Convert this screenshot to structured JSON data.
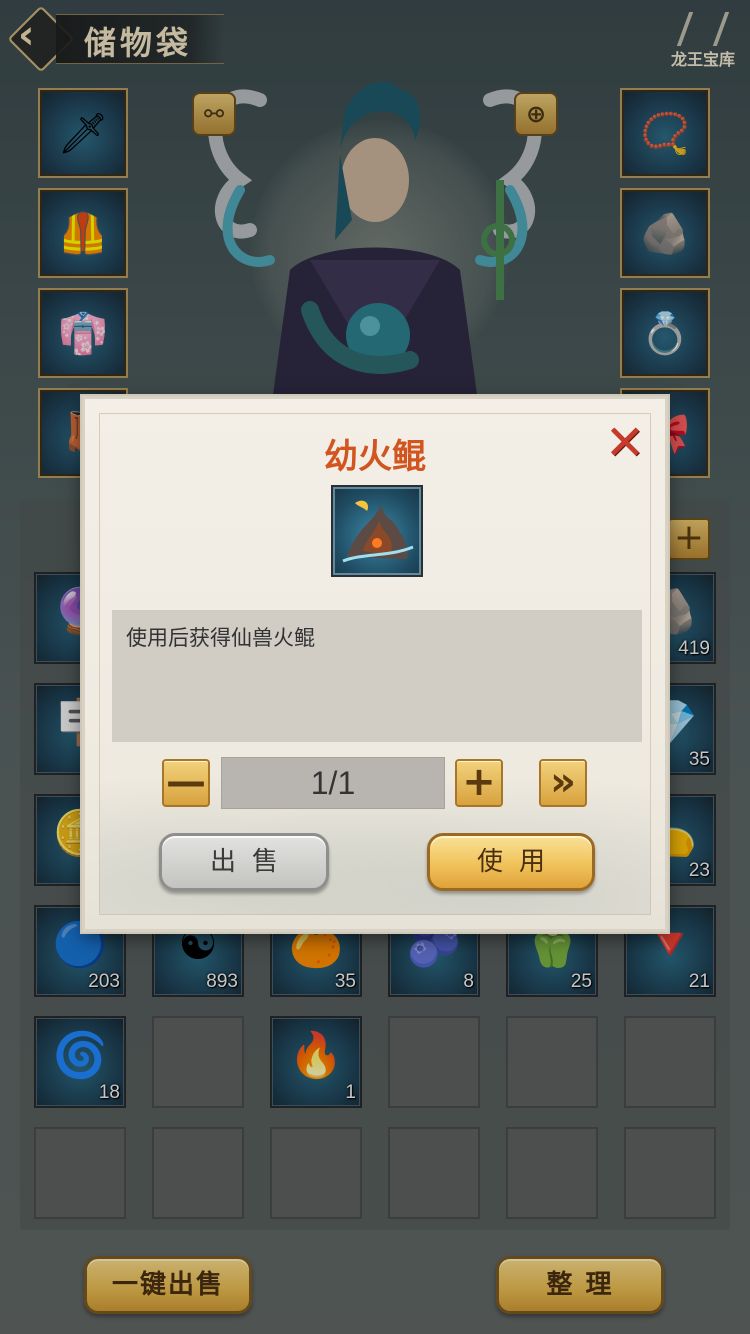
{
  "header": {
    "title": "储物袋",
    "logo_text": "龙王宝库"
  },
  "hero": {
    "left_button_icon": "armor-swap-icon",
    "right_button_icon": "magnify-icon"
  },
  "equipment": {
    "left": [
      {
        "icon": "sword-icon",
        "glyph": "🗡"
      },
      {
        "icon": "armor-icon",
        "glyph": "🦺"
      },
      {
        "icon": "robe-icon",
        "glyph": "👘"
      },
      {
        "icon": "boots-icon",
        "glyph": "👢"
      }
    ],
    "right": [
      {
        "icon": "bracelet-icon",
        "glyph": "📿"
      },
      {
        "icon": "jade-icon",
        "glyph": "🪨"
      },
      {
        "icon": "ring-icon",
        "glyph": "💍"
      },
      {
        "icon": "belt-icon",
        "glyph": "🎀"
      }
    ]
  },
  "inventory": {
    "rows": [
      [
        {
          "icon": "crystal-icon",
          "glyph": "🔮",
          "count": ""
        },
        {
          "icon": "",
          "glyph": "",
          "count": ""
        },
        {
          "icon": "",
          "glyph": "",
          "count": ""
        },
        {
          "icon": "",
          "glyph": "",
          "count": ""
        },
        {
          "icon": "",
          "glyph": "",
          "count": ""
        },
        {
          "icon": "ore-icon",
          "glyph": "🪨",
          "count": "419"
        }
      ],
      [
        {
          "icon": "token-icon",
          "glyph": "🪧",
          "count": ""
        },
        {
          "icon": "",
          "glyph": "",
          "count": ""
        },
        {
          "icon": "",
          "glyph": "",
          "count": ""
        },
        {
          "icon": "",
          "glyph": "",
          "count": ""
        },
        {
          "icon": "",
          "glyph": "",
          "count": ""
        },
        {
          "icon": "emerald-icon",
          "glyph": "💎",
          "count": "35"
        }
      ],
      [
        {
          "icon": "coin-icon",
          "glyph": "🪙",
          "count": ""
        },
        {
          "icon": "",
          "glyph": "",
          "count": ""
        },
        {
          "icon": "",
          "glyph": "",
          "count": ""
        },
        {
          "icon": "",
          "glyph": "",
          "count": ""
        },
        {
          "icon": "",
          "glyph": "",
          "count": ""
        },
        {
          "icon": "pouch-icon",
          "glyph": "👝",
          "count": "23"
        }
      ],
      [
        {
          "icon": "orb-icon",
          "glyph": "🔵",
          "count": "203"
        },
        {
          "icon": "yinyang-icon",
          "glyph": "☯",
          "count": "893"
        },
        {
          "icon": "fruit-icon",
          "glyph": "🍊",
          "count": "35"
        },
        {
          "icon": "berries-icon",
          "glyph": "🫐",
          "count": "8"
        },
        {
          "icon": "pepper-icon",
          "glyph": "🫑",
          "count": "25"
        },
        {
          "icon": "talisman-icon",
          "glyph": "🔻",
          "count": "21"
        }
      ],
      [
        {
          "icon": "pearl-icon",
          "glyph": "🌀",
          "count": "18"
        },
        {
          "icon": "",
          "glyph": "",
          "count": ""
        },
        {
          "icon": "fire-kun-egg-icon",
          "glyph": "🔥",
          "count": "1"
        },
        {
          "icon": "",
          "glyph": "",
          "count": ""
        },
        {
          "icon": "",
          "glyph": "",
          "count": ""
        },
        {
          "icon": "",
          "glyph": "",
          "count": ""
        }
      ],
      [
        {
          "icon": "",
          "glyph": "",
          "count": ""
        },
        {
          "icon": "",
          "glyph": "",
          "count": ""
        },
        {
          "icon": "",
          "glyph": "",
          "count": ""
        },
        {
          "icon": "",
          "glyph": "",
          "count": ""
        },
        {
          "icon": "",
          "glyph": "",
          "count": ""
        },
        {
          "icon": "",
          "glyph": "",
          "count": ""
        }
      ]
    ]
  },
  "bottom": {
    "sell_all_label": "一键出售",
    "sort_label": "整 理"
  },
  "modal": {
    "title": "幼火鲲",
    "item_icon": "fire-kun-egg-icon",
    "item_glyph": "🔥",
    "description": "使用后获得仙兽火鲲",
    "quantity": "1/1",
    "minus_label": "—",
    "plus_label": "+",
    "max_label": "»",
    "sell_label": "出售",
    "use_label": "使用",
    "close_label": "✕"
  },
  "colors": {
    "title_accent": "#d2541f",
    "close_red": "#c63a2a",
    "gold_button": "#f0c35a"
  }
}
